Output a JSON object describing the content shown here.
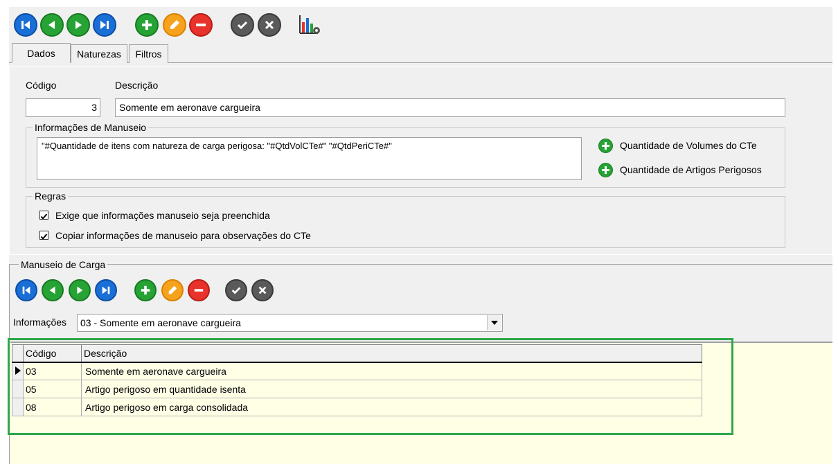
{
  "toolbar_top": {
    "buttons": [
      "first-icon",
      "prev-icon",
      "next-icon",
      "last-icon",
      "add-icon",
      "edit-icon",
      "remove-icon",
      "confirm-icon",
      "cancel-icon",
      "report-icon"
    ]
  },
  "tabs": [
    {
      "label": "Dados"
    },
    {
      "label": "Naturezas"
    },
    {
      "label": "Filtros"
    }
  ],
  "form": {
    "codigo_label": "Código",
    "codigo_value": "3",
    "descricao_label": "Descrição",
    "descricao_value": "Somente em aeronave cargueira"
  },
  "manuseio": {
    "legend": "Informações de Manuseio",
    "text": "\"#Quantidade de itens com natureza de carga perigosa: \"#QtdVolCTe#\" \"#QtdPeriCTe#\"",
    "btn_volumes": "Quantidade de Volumes do CTe",
    "btn_artigos": "Quantidade de Artigos Perigosos"
  },
  "regras": {
    "legend": "Regras",
    "check1": "Exige que informações manuseio seja preenchida",
    "check2": "Copiar informações de manuseio para observações do CTe",
    "check1_checked": true,
    "check2_checked": true
  },
  "carga": {
    "legend": "Manuseio de Carga",
    "informacoes_label": "Informações",
    "informacoes_value": "03 - Somente em aeronave cargueira",
    "table": {
      "headers": [
        "Código",
        "Descrição"
      ],
      "rows": [
        {
          "codigo": "03",
          "descricao": "Somente em aeronave cargueira"
        },
        {
          "codigo": "05",
          "descricao": "Artigo perigoso em quantidade isenta"
        },
        {
          "codigo": "08",
          "descricao": "Artigo perigoso em carga consolidada"
        }
      ]
    }
  },
  "colors": {
    "window_bg": "#f0f0f0",
    "grid_bg": "#ffffe6",
    "highlight_border": "#2ea84a",
    "nav_blue": "#1a6fd6",
    "action_green": "#27a336",
    "edit_orange": "#f6a21d",
    "remove_red": "#e7332b",
    "confirm_gray": "#5a5a5a"
  }
}
